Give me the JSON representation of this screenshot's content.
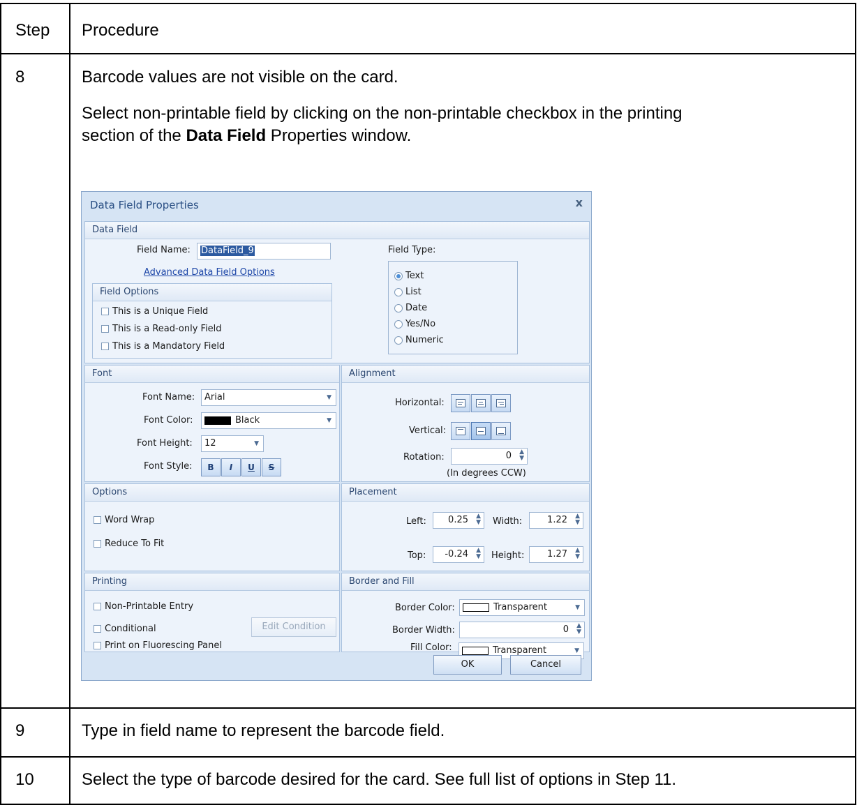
{
  "table": {
    "header": {
      "step": "Step",
      "procedure": "Procedure"
    },
    "rows": [
      {
        "step": "8",
        "line1": "Barcode values are not visible on the card.",
        "line2": "Select non-printable field by clicking on the non-printable checkbox in the printing",
        "line3_pre": "section of the ",
        "line3_bold": "Data Field",
        "line3_post": " Properties window."
      },
      {
        "step": "9",
        "text": "Type in field name to represent the barcode field."
      },
      {
        "step": "10",
        "text": "Select the type of barcode desired for the card.  See full list of options in Step 11."
      }
    ]
  },
  "dialog": {
    "title": "Data Field Properties",
    "close": "x",
    "data_field": {
      "header": "Data Field",
      "field_name_label": "Field Name:",
      "field_name_value": "DataField_9",
      "advanced_link": "Advanced Data Field Options",
      "field_type_label": "Field Type:",
      "field_types": [
        "Text",
        "List",
        "Date",
        "Yes/No",
        "Numeric"
      ],
      "field_type_selected": "Text",
      "field_options_header": "Field Options",
      "field_options": [
        "This is a Unique Field",
        "This is a Read-only Field",
        "This is a Mandatory Field"
      ]
    },
    "font": {
      "header": "Font",
      "name_label": "Font Name:",
      "name_value": "Arial",
      "color_label": "Font Color:",
      "color_value": "Black",
      "color_hex": "#000000",
      "height_label": "Font Height:",
      "height_value": "12",
      "style_label": "Font Style:",
      "styles": [
        "B",
        "I",
        "U",
        "S"
      ]
    },
    "alignment": {
      "header": "Alignment",
      "horizontal_label": "Horizontal:",
      "vertical_label": "Vertical:",
      "rotation_label": "Rotation:",
      "rotation_value": "0",
      "rotation_note": "(In degrees CCW)"
    },
    "options": {
      "header": "Options",
      "items": [
        "Word Wrap",
        "Reduce To Fit"
      ]
    },
    "placement": {
      "header": "Placement",
      "left_label": "Left:",
      "left_value": "0.25",
      "width_label": "Width:",
      "width_value": "1.22",
      "top_label": "Top:",
      "top_value": "-0.24",
      "height_label": "Height:",
      "height_value": "1.27"
    },
    "printing": {
      "header": "Printing",
      "items": [
        "Non-Printable Entry",
        "Conditional",
        "Print on Fluorescing Panel"
      ],
      "edit_condition": "Edit Condition"
    },
    "border_fill": {
      "header": "Border and Fill",
      "border_color_label": "Border Color:",
      "border_color_value": "Transparent",
      "border_width_label": "Border Width:",
      "border_width_value": "0",
      "fill_color_label": "Fill Color:",
      "fill_color_value": "Transparent"
    },
    "buttons": {
      "ok": "OK",
      "cancel": "Cancel"
    }
  }
}
